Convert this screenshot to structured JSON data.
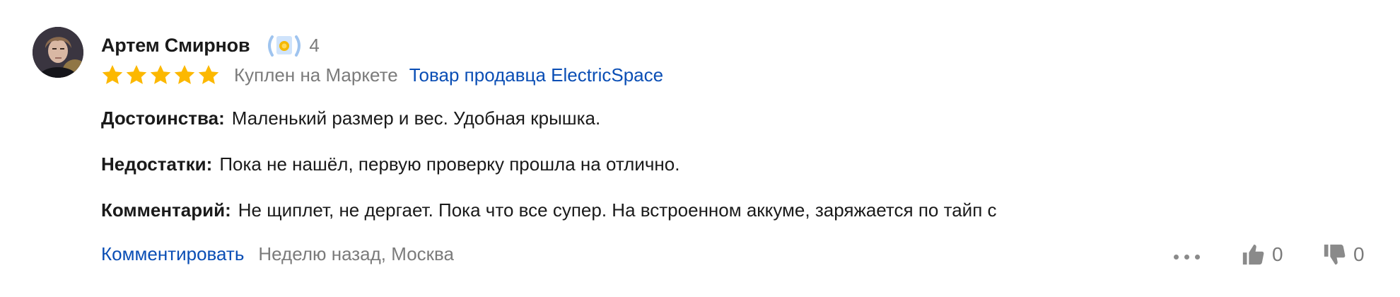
{
  "review": {
    "author": "Артем Смирнов",
    "level": "4",
    "rating": 5,
    "purchase_status": "Куплен на Маркете",
    "seller_link": "Товар продавца ElectricSpace",
    "fields": [
      {
        "label": "Достоинства:",
        "text": "Маленький размер и вес. Удобная крышка."
      },
      {
        "label": "Недостатки:",
        "text": "Пока не нашёл, первую проверку прошла на отлично."
      },
      {
        "label": "Комментарий:",
        "text": "Не щиплет, не дергает. Пока что все супер. На встроенном аккуме, заряжается по тайп с"
      }
    ],
    "comment_link": "Комментировать",
    "date": "Неделю назад, Москва",
    "likes": "0",
    "dislikes": "0"
  },
  "colors": {
    "star": "#fcb800",
    "link": "#0a4eb5",
    "muted": "#7b7b7b"
  },
  "icons": [
    "avatar",
    "reviewer-badge-icon",
    "star-icon",
    "more-icon",
    "thumbs-up-icon",
    "thumbs-down-icon"
  ]
}
